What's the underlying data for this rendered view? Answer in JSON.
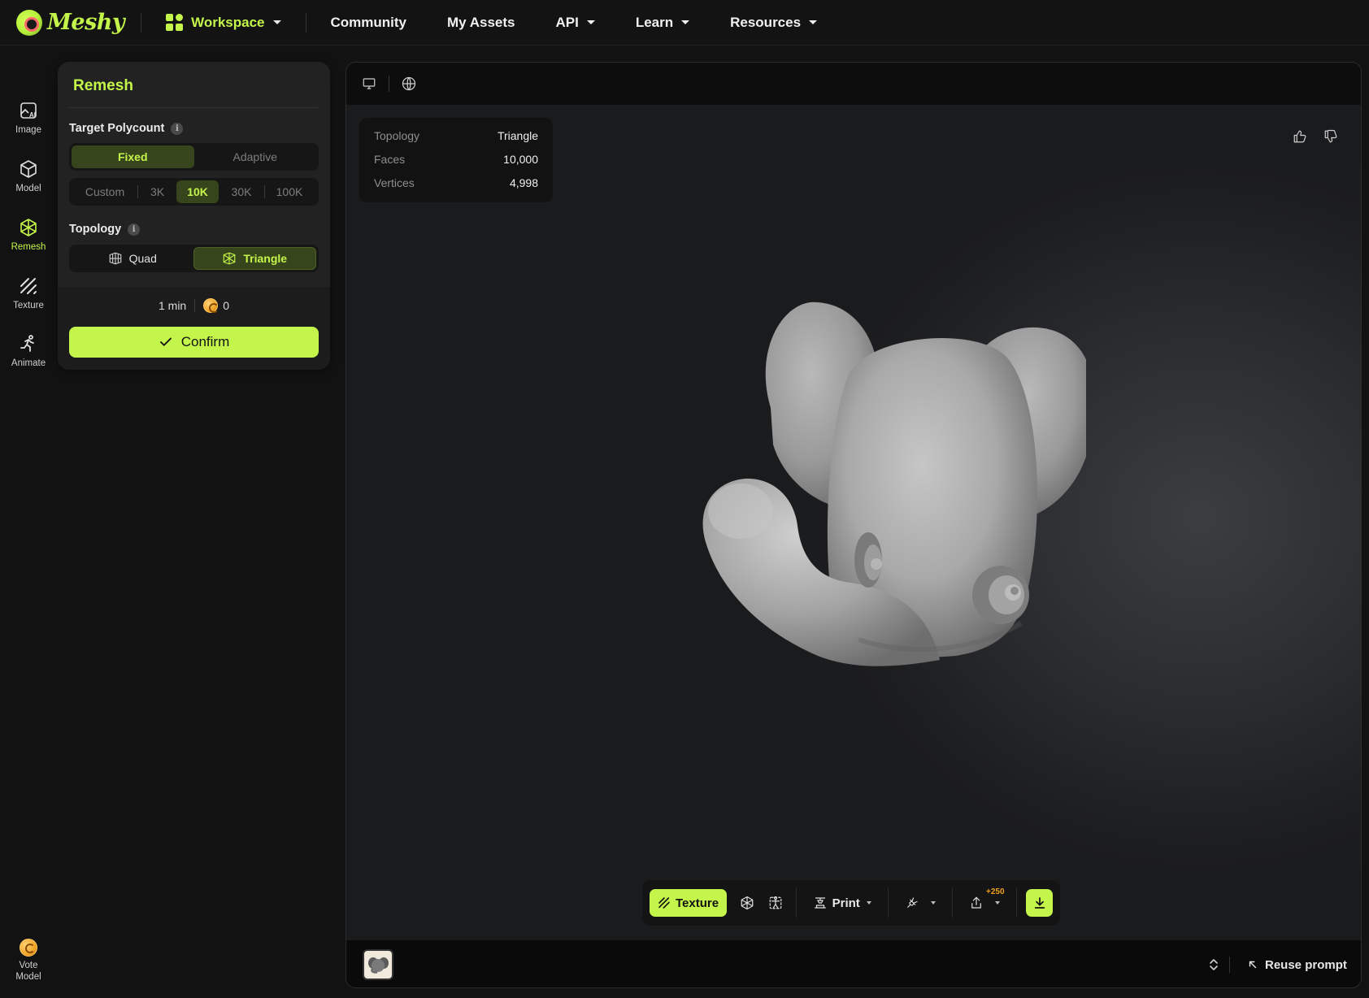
{
  "brand": {
    "name": "Meshy",
    "accent": "#c4f54a"
  },
  "nav": {
    "workspace": "Workspace",
    "community": "Community",
    "my_assets": "My Assets",
    "api": "API",
    "learn": "Learn",
    "resources": "Resources"
  },
  "rail": {
    "items": [
      {
        "label": "Image",
        "icon": "image-ai-icon"
      },
      {
        "label": "Model",
        "icon": "cube-icon"
      },
      {
        "label": "Remesh",
        "icon": "remesh-icon",
        "active": true
      },
      {
        "label": "Texture",
        "icon": "texture-icon"
      },
      {
        "label": "Animate",
        "icon": "running-figure-icon"
      }
    ],
    "vote_line1": "Vote",
    "vote_line2": "Model"
  },
  "remesh": {
    "title": "Remesh",
    "target_polycount_label": "Target Polycount",
    "mode_options": [
      "Fixed",
      "Adaptive"
    ],
    "mode_selected": "Fixed",
    "polycount_options": [
      "Custom",
      "3K",
      "10K",
      "30K",
      "100K"
    ],
    "polycount_selected": "10K",
    "topology_label": "Topology",
    "topology_options": [
      "Quad",
      "Triangle"
    ],
    "topology_selected": "Triangle",
    "time_estimate": "1 min",
    "credit_cost": "0",
    "confirm_label": "Confirm"
  },
  "viewer": {
    "stats": [
      {
        "key": "Topology",
        "value": "Triangle"
      },
      {
        "key": "Faces",
        "value": "10,000"
      },
      {
        "key": "Vertices",
        "value": "4,998"
      }
    ],
    "toolbar": {
      "texture_label": "Texture",
      "print_label": "Print",
      "share_badge": "+250"
    },
    "reuse_prompt_label": "Reuse prompt"
  }
}
